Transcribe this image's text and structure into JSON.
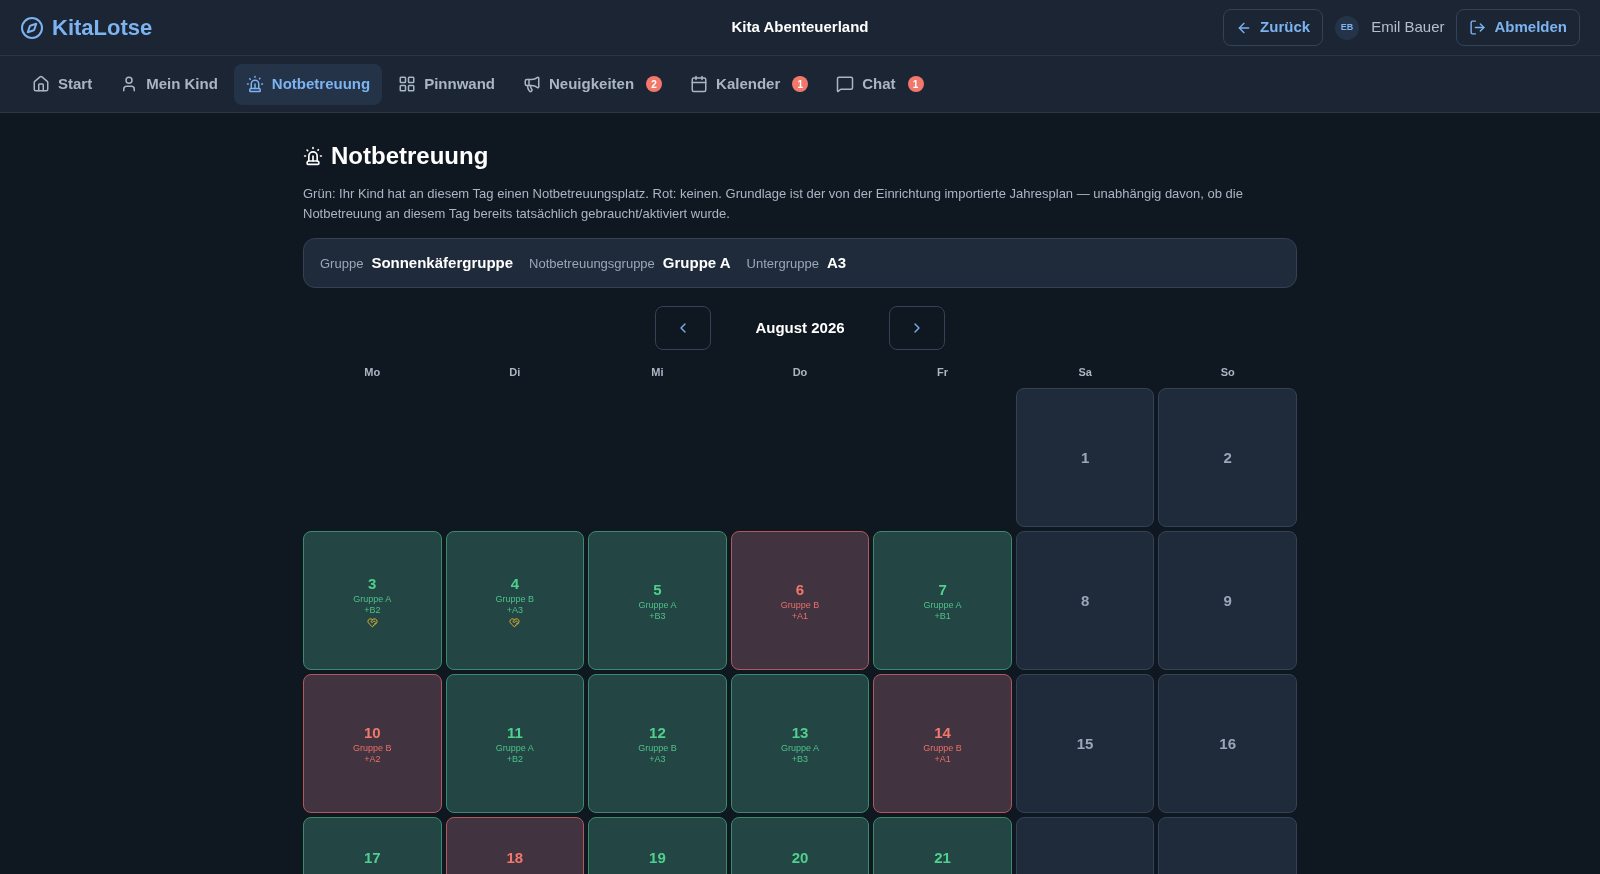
{
  "header": {
    "logo": "KitaLotse",
    "title": "Kita Abenteuerland",
    "back_button": "Zurück",
    "user": {
      "initials": "EB",
      "name": "Emil Bauer"
    },
    "logout_button": "Abmelden"
  },
  "nav": [
    {
      "label": "Start",
      "kind": "home",
      "selected": false
    },
    {
      "label": "Mein Kind",
      "kind": "user",
      "selected": false
    },
    {
      "label": "Notbetreuung",
      "kind": "siren",
      "selected": true
    },
    {
      "label": "Pinnwand",
      "kind": "grid",
      "selected": false
    },
    {
      "label": "Neuigkeiten",
      "kind": "megaphone",
      "selected": false,
      "badge": "2"
    },
    {
      "label": "Kalender",
      "kind": "calendar",
      "selected": false,
      "badge": "1"
    },
    {
      "label": "Chat",
      "kind": "chat",
      "selected": false,
      "badge": "1"
    }
  ],
  "page": {
    "title": "Notbetreuung",
    "description": "Grün: Ihr Kind hat an diesem Tag einen Notbetreuungsplatz. Rot: keinen. Grundlage ist der von der Einrichtung importierte Jahresplan — unabhängig davon, ob die Notbetreuung an diesem Tag bereits tatsächlich gebraucht/aktiviert wurde.",
    "info": [
      {
        "label": "Gruppe",
        "value": "Sonnenkäfergruppe"
      },
      {
        "label": "Notbetreuungsgruppe",
        "value": "Gruppe A"
      },
      {
        "label": "Untergruppe",
        "value": "A3"
      }
    ]
  },
  "calendar": {
    "month": "August 2026",
    "weekdays": [
      "Mo",
      "Di",
      "Mi",
      "Do",
      "Fr",
      "Sa",
      "So"
    ],
    "weeks": [
      [
        {
          "kind": "blank"
        },
        {
          "kind": "blank"
        },
        {
          "kind": "blank"
        },
        {
          "kind": "blank"
        },
        {
          "kind": "blank"
        },
        {
          "kind": "weekend",
          "day": "1"
        },
        {
          "kind": "weekend",
          "day": "2"
        }
      ],
      [
        {
          "kind": "place",
          "day": "3",
          "group": "Gruppe A",
          "extra": "+B2",
          "marked": true
        },
        {
          "kind": "place",
          "day": "4",
          "group": "Gruppe B",
          "extra": "+A3",
          "marked": true
        },
        {
          "kind": "place",
          "day": "5",
          "group": "Gruppe A",
          "extra": "+B3",
          "marked": false
        },
        {
          "kind": "none",
          "day": "6",
          "group": "Gruppe B",
          "extra": "+A1",
          "marked": false
        },
        {
          "kind": "place",
          "day": "7",
          "group": "Gruppe A",
          "extra": "+B1",
          "marked": false
        },
        {
          "kind": "weekend",
          "day": "8"
        },
        {
          "kind": "weekend",
          "day": "9"
        }
      ],
      [
        {
          "kind": "none",
          "day": "10",
          "group": "Gruppe B",
          "extra": "+A2",
          "marked": false
        },
        {
          "kind": "place",
          "day": "11",
          "group": "Gruppe A",
          "extra": "+B2",
          "marked": false
        },
        {
          "kind": "place",
          "day": "12",
          "group": "Gruppe B",
          "extra": "+A3",
          "marked": false
        },
        {
          "kind": "place",
          "day": "13",
          "group": "Gruppe A",
          "extra": "+B3",
          "marked": false
        },
        {
          "kind": "none",
          "day": "14",
          "group": "Gruppe B",
          "extra": "+A1",
          "marked": false
        },
        {
          "kind": "weekend",
          "day": "15"
        },
        {
          "kind": "weekend",
          "day": "16"
        }
      ],
      [
        {
          "kind": "place",
          "day": "17"
        },
        {
          "kind": "none",
          "day": "18"
        },
        {
          "kind": "place",
          "day": "19"
        },
        {
          "kind": "place",
          "day": "20"
        },
        {
          "kind": "place",
          "day": "21"
        },
        {
          "kind": "weekend"
        },
        {
          "kind": "weekend"
        }
      ]
    ]
  }
}
